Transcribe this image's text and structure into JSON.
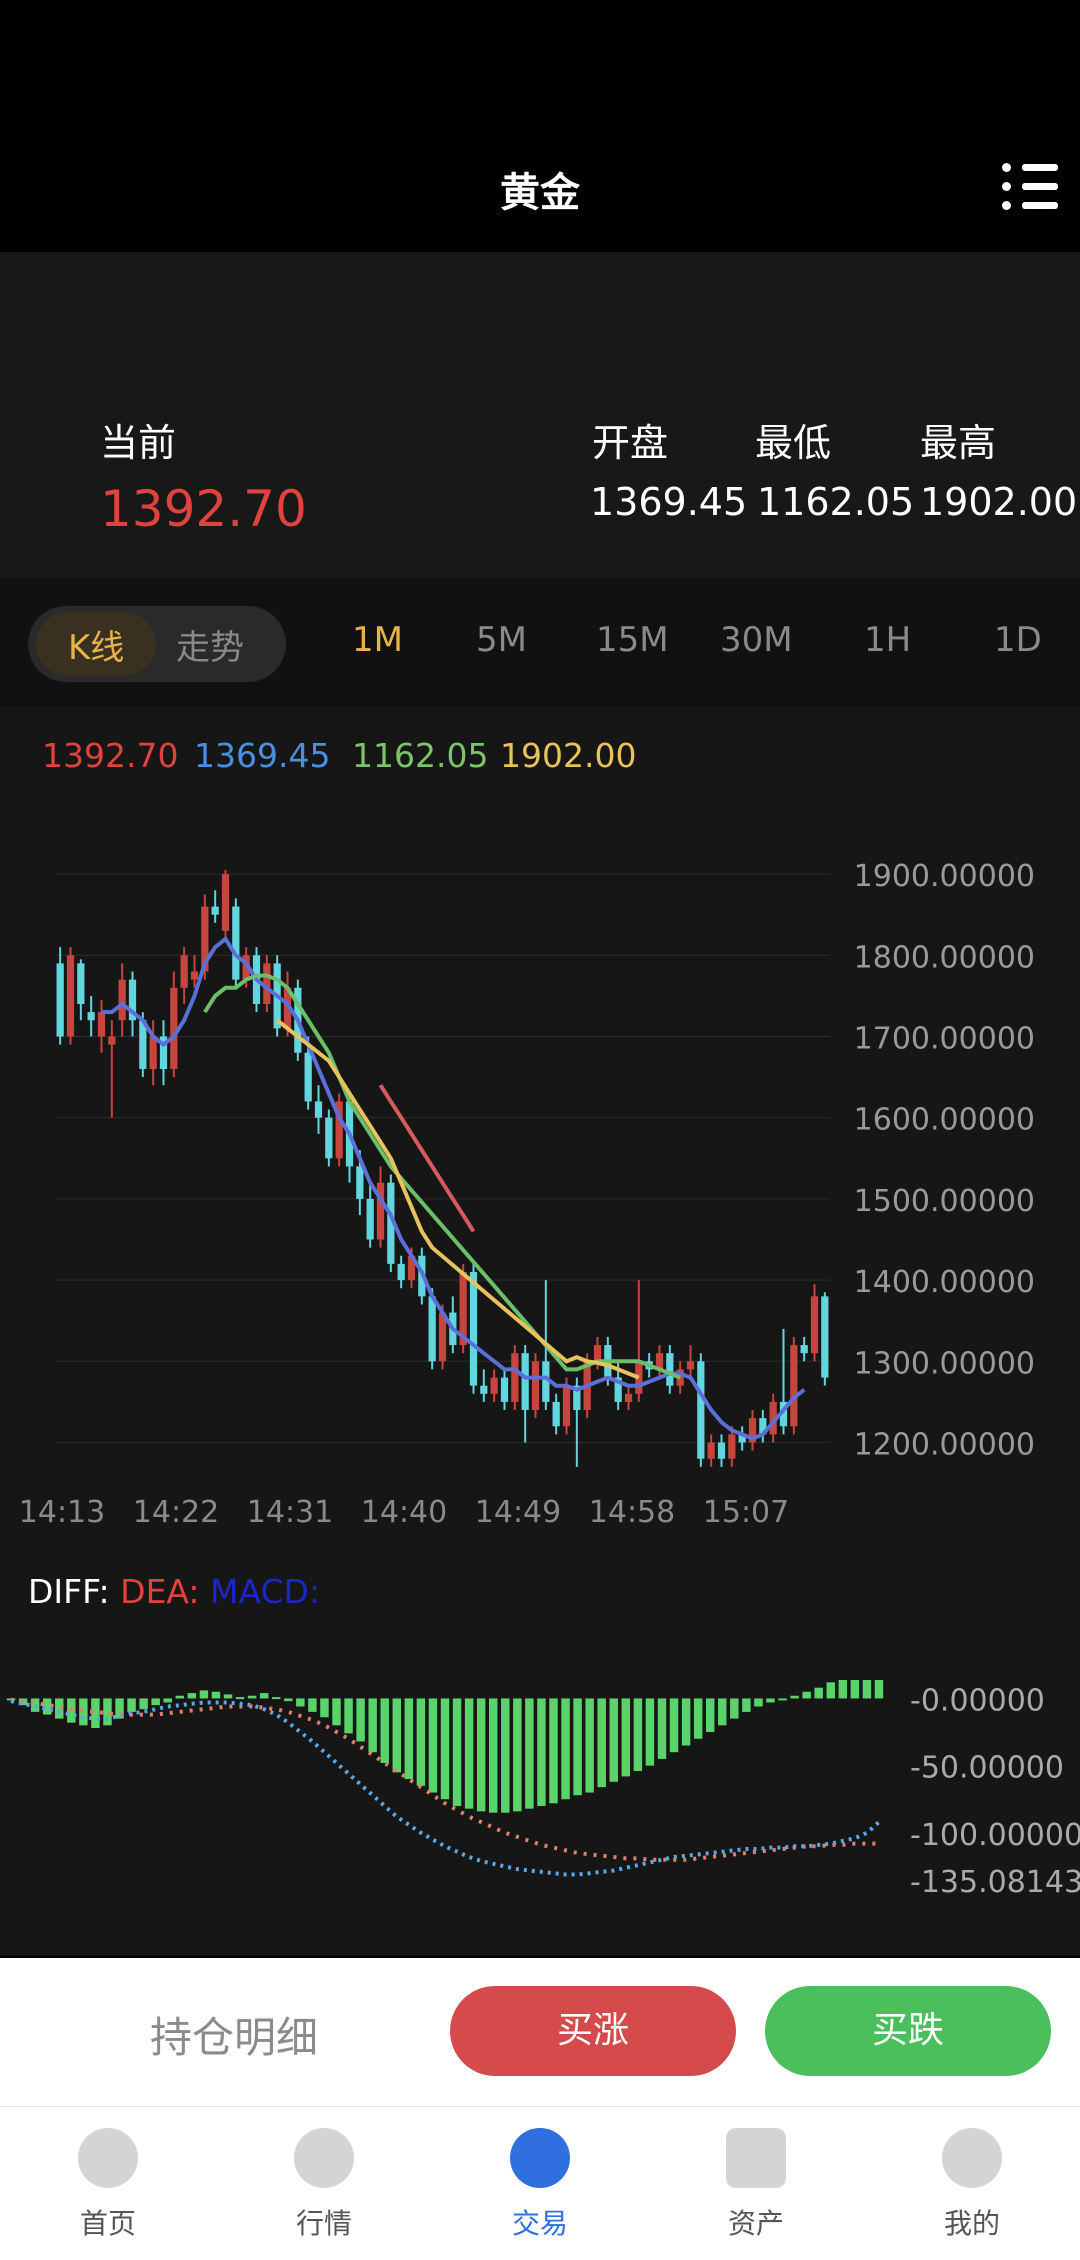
{
  "header": {
    "title": "黄金"
  },
  "price": {
    "current_label": "当前",
    "current_value": "1392.70",
    "open_label": "开盘",
    "low_label": "最低",
    "high_label": "最高",
    "open_value": "1369.45",
    "low_value": "1162.05",
    "high_value": "1902.00"
  },
  "tabs": {
    "kline": "K线",
    "trend": "走势",
    "timeframes": [
      "1M",
      "5M",
      "15M",
      "30M",
      "1H",
      "1D"
    ],
    "selected": "1M"
  },
  "ma_legend": [
    {
      "text": "1392.70",
      "color": "#e0433d"
    },
    {
      "text": "1369.45",
      "color": "#4a90e2"
    },
    {
      "text": "1162.05",
      "color": "#7cc46a"
    },
    {
      "text": "1902.00",
      "color": "#e8c25a"
    }
  ],
  "chart_data": [
    {
      "type": "candlestick",
      "x_labels": [
        "14:13",
        "14:22",
        "14:31",
        "14:40",
        "14:49",
        "14:58",
        "15:07"
      ],
      "y_ticks": [
        "1900.00000",
        "1800.00000",
        "1700.00000",
        "1600.00000",
        "1500.00000",
        "1400.00000",
        "1300.00000",
        "1200.00000"
      ],
      "ylim": [
        1160,
        1905
      ],
      "up_color": "#c7453f",
      "down_color": "#62d6df",
      "candles": [
        {
          "o": 1790,
          "c": 1700,
          "h": 1810,
          "l": 1690
        },
        {
          "o": 1700,
          "c": 1800,
          "h": 1810,
          "l": 1690
        },
        {
          "o": 1790,
          "c": 1740,
          "h": 1795,
          "l": 1720
        },
        {
          "o": 1730,
          "c": 1720,
          "h": 1750,
          "l": 1700
        },
        {
          "o": 1700,
          "c": 1730,
          "h": 1745,
          "l": 1680
        },
        {
          "o": 1690,
          "c": 1700,
          "h": 1720,
          "l": 1600
        },
        {
          "o": 1720,
          "c": 1770,
          "h": 1790,
          "l": 1700
        },
        {
          "o": 1770,
          "c": 1720,
          "h": 1780,
          "l": 1700
        },
        {
          "o": 1720,
          "c": 1660,
          "h": 1730,
          "l": 1650
        },
        {
          "o": 1660,
          "c": 1700,
          "h": 1720,
          "l": 1640
        },
        {
          "o": 1700,
          "c": 1660,
          "h": 1720,
          "l": 1640
        },
        {
          "o": 1660,
          "c": 1760,
          "h": 1780,
          "l": 1650
        },
        {
          "o": 1760,
          "c": 1800,
          "h": 1810,
          "l": 1740
        },
        {
          "o": 1770,
          "c": 1780,
          "h": 1800,
          "l": 1760
        },
        {
          "o": 1780,
          "c": 1860,
          "h": 1875,
          "l": 1770
        },
        {
          "o": 1860,
          "c": 1850,
          "h": 1880,
          "l": 1840
        },
        {
          "o": 1830,
          "c": 1900,
          "h": 1905,
          "l": 1820
        },
        {
          "o": 1860,
          "c": 1770,
          "h": 1870,
          "l": 1760
        },
        {
          "o": 1770,
          "c": 1800,
          "h": 1810,
          "l": 1760
        },
        {
          "o": 1800,
          "c": 1740,
          "h": 1810,
          "l": 1730
        },
        {
          "o": 1740,
          "c": 1790,
          "h": 1800,
          "l": 1730
        },
        {
          "o": 1790,
          "c": 1710,
          "h": 1800,
          "l": 1700
        },
        {
          "o": 1710,
          "c": 1760,
          "h": 1780,
          "l": 1700
        },
        {
          "o": 1760,
          "c": 1680,
          "h": 1770,
          "l": 1670
        },
        {
          "o": 1680,
          "c": 1620,
          "h": 1700,
          "l": 1610
        },
        {
          "o": 1620,
          "c": 1600,
          "h": 1640,
          "l": 1580
        },
        {
          "o": 1600,
          "c": 1550,
          "h": 1610,
          "l": 1540
        },
        {
          "o": 1550,
          "c": 1620,
          "h": 1630,
          "l": 1540
        },
        {
          "o": 1620,
          "c": 1540,
          "h": 1625,
          "l": 1520
        },
        {
          "o": 1540,
          "c": 1500,
          "h": 1560,
          "l": 1480
        },
        {
          "o": 1500,
          "c": 1450,
          "h": 1520,
          "l": 1440
        },
        {
          "o": 1450,
          "c": 1520,
          "h": 1540,
          "l": 1440
        },
        {
          "o": 1520,
          "c": 1420,
          "h": 1530,
          "l": 1410
        },
        {
          "o": 1420,
          "c": 1400,
          "h": 1430,
          "l": 1390
        },
        {
          "o": 1400,
          "c": 1430,
          "h": 1440,
          "l": 1390
        },
        {
          "o": 1430,
          "c": 1380,
          "h": 1440,
          "l": 1370
        },
        {
          "o": 1380,
          "c": 1300,
          "h": 1390,
          "l": 1290
        },
        {
          "o": 1300,
          "c": 1360,
          "h": 1370,
          "l": 1290
        },
        {
          "o": 1360,
          "c": 1320,
          "h": 1380,
          "l": 1310
        },
        {
          "o": 1320,
          "c": 1410,
          "h": 1420,
          "l": 1310
        },
        {
          "o": 1410,
          "c": 1270,
          "h": 1420,
          "l": 1260
        },
        {
          "o": 1270,
          "c": 1260,
          "h": 1290,
          "l": 1250
        },
        {
          "o": 1260,
          "c": 1280,
          "h": 1290,
          "l": 1250
        },
        {
          "o": 1280,
          "c": 1250,
          "h": 1290,
          "l": 1240
        },
        {
          "o": 1250,
          "c": 1310,
          "h": 1320,
          "l": 1240
        },
        {
          "o": 1310,
          "c": 1240,
          "h": 1320,
          "l": 1200
        },
        {
          "o": 1240,
          "c": 1300,
          "h": 1310,
          "l": 1230
        },
        {
          "o": 1300,
          "c": 1250,
          "h": 1400,
          "l": 1240
        },
        {
          "o": 1250,
          "c": 1220,
          "h": 1260,
          "l": 1210
        },
        {
          "o": 1220,
          "c": 1270,
          "h": 1280,
          "l": 1210
        },
        {
          "o": 1270,
          "c": 1240,
          "h": 1280,
          "l": 1170
        },
        {
          "o": 1240,
          "c": 1300,
          "h": 1310,
          "l": 1230
        },
        {
          "o": 1300,
          "c": 1320,
          "h": 1330,
          "l": 1290
        },
        {
          "o": 1320,
          "c": 1280,
          "h": 1330,
          "l": 1270
        },
        {
          "o": 1280,
          "c": 1250,
          "h": 1300,
          "l": 1240
        },
        {
          "o": 1250,
          "c": 1260,
          "h": 1270,
          "l": 1240
        },
        {
          "o": 1260,
          "c": 1300,
          "h": 1400,
          "l": 1250
        },
        {
          "o": 1300,
          "c": 1290,
          "h": 1310,
          "l": 1280
        },
        {
          "o": 1290,
          "c": 1310,
          "h": 1320,
          "l": 1280
        },
        {
          "o": 1310,
          "c": 1270,
          "h": 1320,
          "l": 1260
        },
        {
          "o": 1270,
          "c": 1290,
          "h": 1300,
          "l": 1260
        },
        {
          "o": 1290,
          "c": 1300,
          "h": 1320,
          "l": 1280
        },
        {
          "o": 1300,
          "c": 1180,
          "h": 1310,
          "l": 1170
        },
        {
          "o": 1180,
          "c": 1200,
          "h": 1210,
          "l": 1170
        },
        {
          "o": 1200,
          "c": 1180,
          "h": 1210,
          "l": 1170
        },
        {
          "o": 1180,
          "c": 1210,
          "h": 1220,
          "l": 1170
        },
        {
          "o": 1210,
          "c": 1200,
          "h": 1220,
          "l": 1190
        },
        {
          "o": 1200,
          "c": 1230,
          "h": 1240,
          "l": 1190
        },
        {
          "o": 1230,
          "c": 1210,
          "h": 1240,
          "l": 1200
        },
        {
          "o": 1210,
          "c": 1250,
          "h": 1260,
          "l": 1200
        },
        {
          "o": 1250,
          "c": 1220,
          "h": 1340,
          "l": 1210
        },
        {
          "o": 1220,
          "c": 1320,
          "h": 1330,
          "l": 1210
        },
        {
          "o": 1320,
          "c": 1310,
          "h": 1330,
          "l": 1300
        },
        {
          "o": 1310,
          "c": 1380,
          "h": 1395,
          "l": 1300
        },
        {
          "o": 1380,
          "c": 1280,
          "h": 1385,
          "l": 1270
        }
      ],
      "ma_lines": [
        {
          "color": "#5a6fd8",
          "values": [
            null,
            null,
            null,
            null,
            1730,
            1730,
            1740,
            1730,
            1720,
            1700,
            1690,
            1700,
            1720,
            1750,
            1790,
            1810,
            1820,
            1800,
            1790,
            1770,
            1760,
            1750,
            1740,
            1720,
            1690,
            1660,
            1630,
            1600,
            1580,
            1550,
            1520,
            1500,
            1480,
            1450,
            1430,
            1410,
            1380,
            1360,
            1340,
            1330,
            1320,
            1310,
            1300,
            1290,
            1290,
            1280,
            1280,
            1280,
            1270,
            1270,
            1265,
            1270,
            1275,
            1280,
            1275,
            1270,
            1270,
            1275,
            1280,
            1285,
            1285,
            1280,
            1260,
            1240,
            1225,
            1215,
            1210,
            1205,
            1210,
            1225,
            1240,
            1255,
            1265
          ]
        },
        {
          "color": "#6bbf68",
          "values": [
            null,
            null,
            null,
            null,
            null,
            null,
            null,
            null,
            null,
            null,
            null,
            null,
            null,
            null,
            1730,
            1750,
            1760,
            1760,
            1770,
            1775,
            1775,
            1770,
            1760,
            1740,
            1720,
            1700,
            1680,
            1650,
            1620,
            1600,
            1580,
            1560,
            1540,
            null,
            null,
            null,
            null,
            null,
            null,
            null,
            null,
            null,
            null,
            null,
            null,
            null,
            null,
            null,
            null,
            1290,
            1290,
            1295,
            1300,
            1300,
            1300,
            1300,
            1300,
            1295,
            1290,
            1285,
            1280
          ]
        },
        {
          "color": "#e8c25a",
          "values": [
            null,
            null,
            null,
            null,
            null,
            null,
            null,
            null,
            null,
            null,
            null,
            null,
            null,
            null,
            null,
            null,
            null,
            null,
            null,
            null,
            null,
            1720,
            1710,
            1700,
            1690,
            1680,
            1670,
            1650,
            1630,
            1610,
            1590,
            1570,
            1550,
            1520,
            1490,
            1460,
            1440,
            null,
            null,
            null,
            null,
            null,
            null,
            null,
            null,
            null,
            null,
            null,
            null,
            1300,
            1305,
            1300,
            1298,
            1295,
            1290,
            1285,
            1280
          ]
        },
        {
          "color": "#d95a5a",
          "values": [
            null,
            null,
            null,
            null,
            null,
            null,
            null,
            null,
            null,
            null,
            null,
            null,
            null,
            null,
            null,
            null,
            null,
            null,
            null,
            null,
            null,
            null,
            null,
            null,
            null,
            null,
            null,
            null,
            null,
            null,
            null,
            1640,
            1620,
            1600,
            1580,
            1560,
            1540,
            1520,
            1500,
            1480,
            1460
          ]
        }
      ]
    },
    {
      "type": "macd",
      "legend": [
        "DIFF:",
        "DEA:",
        "MACD:"
      ],
      "legend_colors": [
        "#ffffff",
        "#e0433d",
        "#1a26c8"
      ],
      "y_ticks": [
        "0.00000",
        "-50.00000",
        "-100.00000",
        "-135.08143"
      ],
      "ylim": [
        -135.08,
        10
      ],
      "histogram": [
        0,
        -5,
        -10,
        -12,
        -15,
        -18,
        -20,
        -22,
        -20,
        -15,
        -10,
        -8,
        -5,
        -3,
        2,
        4,
        6,
        5,
        3,
        1,
        2,
        4,
        1,
        -2,
        -6,
        -10,
        -14,
        -20,
        -26,
        -32,
        -40,
        -48,
        -55,
        -60,
        -65,
        -70,
        -75,
        -80,
        -82,
        -84,
        -85,
        -85,
        -84,
        -82,
        -80,
        -78,
        -75,
        -72,
        -70,
        -66,
        -62,
        -58,
        -54,
        -50,
        -45,
        -40,
        -35,
        -30,
        -25,
        -20,
        -15,
        -10,
        -6,
        -3,
        -1,
        2,
        5,
        8,
        12,
        16,
        20,
        25,
        30
      ],
      "diff": [
        -2,
        -4,
        -6,
        -8,
        -10,
        -12,
        -14,
        -15,
        -15,
        -13,
        -11,
        -10,
        -8,
        -6,
        -5,
        -4,
        -3,
        -3,
        -3,
        -4,
        -5,
        -8,
        -12,
        -18,
        -25,
        -32,
        -40,
        -48,
        -56,
        -64,
        -72,
        -80,
        -88,
        -94,
        -100,
        -105,
        -110,
        -114,
        -118,
        -121,
        -123,
        -125,
        -127,
        -128,
        -129,
        -130,
        -131,
        -131,
        -130,
        -129,
        -128,
        -126,
        -124,
        -122,
        -120,
        -118,
        -117,
        -116,
        -115,
        -114,
        -113,
        -112,
        -112,
        -111,
        -111,
        -110,
        -110,
        -109,
        -108,
        -106,
        -104,
        -100,
        -92
      ],
      "dea": [
        -1,
        -2,
        -3,
        -5,
        -6,
        -8,
        -9,
        -10,
        -11,
        -12,
        -12,
        -12,
        -12,
        -11,
        -10,
        -9,
        -8,
        -7,
        -6,
        -6,
        -6,
        -7,
        -8,
        -10,
        -13,
        -16,
        -20,
        -25,
        -30,
        -36,
        -42,
        -48,
        -54,
        -60,
        -66,
        -72,
        -78,
        -83,
        -88,
        -92,
        -96,
        -100,
        -103,
        -106,
        -109,
        -111,
        -113,
        -115,
        -116,
        -117,
        -118,
        -119,
        -119,
        -120,
        -120,
        -120,
        -120,
        -119,
        -118,
        -117,
        -116,
        -115,
        -114,
        -113,
        -112,
        -111,
        -110,
        -110,
        -109,
        -109,
        -108,
        -108,
        -108
      ]
    }
  ],
  "trade": {
    "position_detail": "持仓明细",
    "buy_up": "买涨",
    "buy_down": "买跌"
  },
  "nav": [
    {
      "label": "首页",
      "icon": "home-icon"
    },
    {
      "label": "行情",
      "icon": "market-icon"
    },
    {
      "label": "交易",
      "icon": "trade-icon"
    },
    {
      "label": "资产",
      "icon": "wallet-icon"
    },
    {
      "label": "我的",
      "icon": "profile-icon"
    }
  ]
}
